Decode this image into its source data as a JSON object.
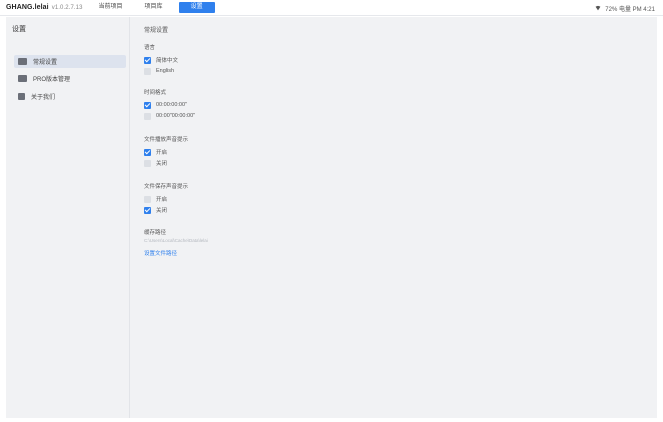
{
  "topbar": {
    "brand": "GHANG.lelai",
    "version": "v1.0.2.7.13",
    "tabs": [
      {
        "label": "当前项目"
      },
      {
        "label": "项目库"
      },
      {
        "label": "设置"
      }
    ],
    "status_text": "72% 电量 PM 4:21"
  },
  "sidebar": {
    "title": "设置",
    "items": [
      {
        "label": "常规设置"
      },
      {
        "label": "PRO版本管理"
      },
      {
        "label": "关于我们"
      }
    ]
  },
  "main": {
    "panel_title": "常规设置",
    "language": {
      "title": "语言",
      "options": [
        {
          "label": "简体中文",
          "checked": true
        },
        {
          "label": "English",
          "checked": false
        }
      ]
    },
    "time_format": {
      "title": "时间格式",
      "options": [
        {
          "label": "00:00:00:00\"",
          "checked": true
        },
        {
          "label": "00:00\"00:00:00\"",
          "checked": false
        }
      ]
    },
    "sound_ext": {
      "title": "文件播放声音提示",
      "options": [
        {
          "label": "开启",
          "checked": true
        },
        {
          "label": "关闭",
          "checked": false
        }
      ]
    },
    "sound_int": {
      "title": "文件保存声音提示",
      "options": [
        {
          "label": "开启",
          "checked": false
        },
        {
          "label": "关闭",
          "checked": true
        }
      ]
    },
    "storage": {
      "title": "缓存路径",
      "hint": "C:\\Users\\Local\\Cache\\Data\\lelai",
      "link": "设置文件路径"
    }
  }
}
